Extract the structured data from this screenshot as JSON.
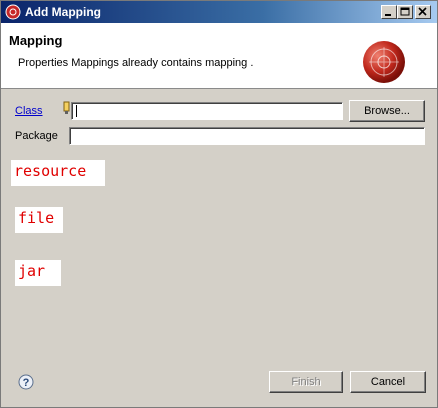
{
  "window": {
    "title": "Add Mapping"
  },
  "titlebar_buttons": {
    "minimize_icon": "minimize-icon",
    "maximize_icon": "maximize-icon",
    "close_icon": "close-icon"
  },
  "header": {
    "title": "Mapping",
    "message": "Properties Mappings already contains mapping ."
  },
  "form": {
    "class_label": "Class",
    "class_value": "",
    "package_label": "Package",
    "package_value": "",
    "browse_label": "Browse..."
  },
  "annotations": [
    "resource",
    "file",
    "jar"
  ],
  "footer": {
    "finish_label": "Finish",
    "cancel_label": "Cancel",
    "finish_enabled": false
  },
  "colors": {
    "title_start": "#0a246a",
    "title_end": "#a6caf0",
    "annotation_text": "#e00000",
    "link": "#0000cc"
  }
}
